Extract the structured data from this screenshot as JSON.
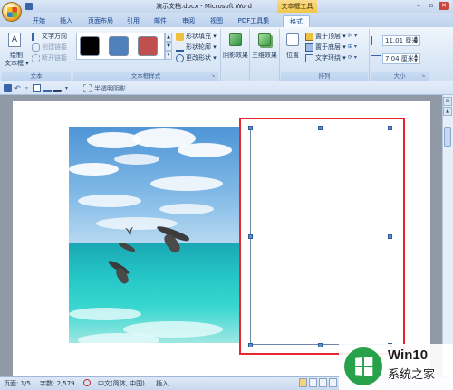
{
  "window": {
    "title": "演示文档.docx - Microsoft Word",
    "context_tools": "文本框工具",
    "controls": [
      "–",
      "▫",
      "✕"
    ]
  },
  "tabs": [
    "开始",
    "插入",
    "页面布局",
    "引用",
    "邮件",
    "审阅",
    "视图",
    "PDF工具集",
    "格式"
  ],
  "ribbon": {
    "text_group": {
      "label": "文本",
      "draw_textbox": "绘制",
      "draw_textbox_2": "文本框 ▾",
      "text_direction": "文字方向",
      "create_link": "创建链接",
      "break_link": "断开链接"
    },
    "styles_group": {
      "label": "文本框样式",
      "swatch_colors": [
        "#000000",
        "#4f81bd",
        "#c0504d"
      ],
      "shape_fill": "形状填充 ▾",
      "shape_outline": "形状轮廓 ▾",
      "change_shape": "更改形状 ▾"
    },
    "shadow": "阴影效果",
    "threed": "三维效果",
    "arrange_group": {
      "label": "排列",
      "position": "位置",
      "bring_front": "置于顶层 ▾",
      "send_back": "置于底层 ▾",
      "wrap": "文字环绕 ▾"
    },
    "size_group": {
      "label": "大小",
      "height": "11.01 厘米",
      "width": "7.04 厘米"
    }
  },
  "qat": {
    "semi_transparent_shadow": "半透明阴影"
  },
  "statusbar": {
    "page": "页面: 1/5",
    "words": "字数: 2,579",
    "language": "中文(简体, 中国)",
    "mode": "插入"
  },
  "watermark": {
    "name": "Win10",
    "sub": "系统之家"
  }
}
